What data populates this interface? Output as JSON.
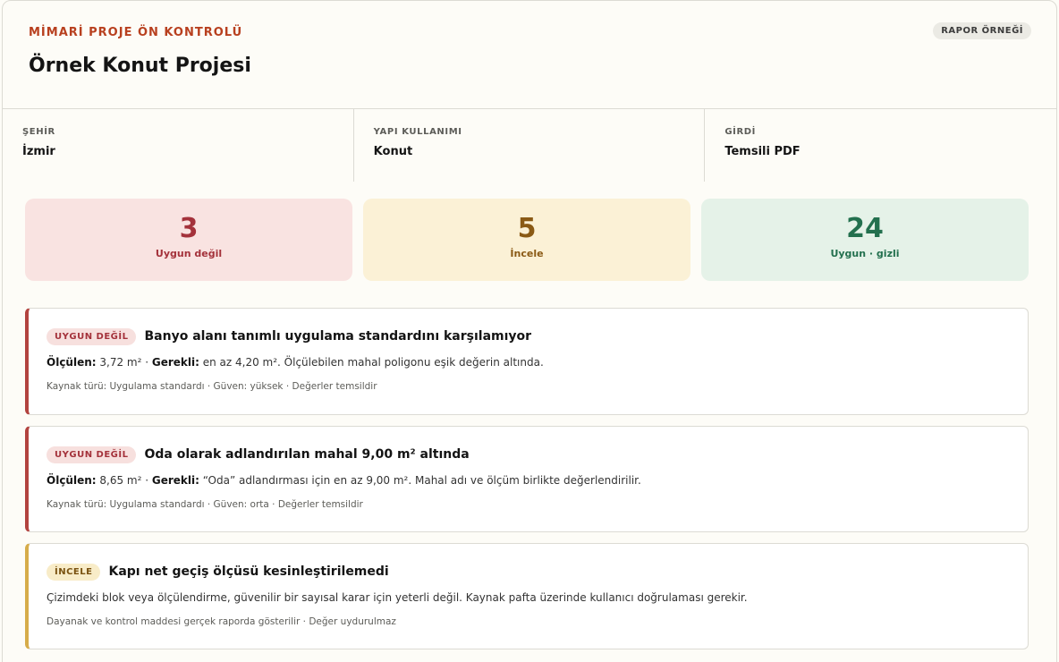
{
  "header": {
    "eyebrow": "MİMARİ PROJE ÖN KONTROLÜ",
    "title": "Örnek Konut Projesi",
    "badge": "RAPOR ÖRNEĞİ"
  },
  "meta": [
    {
      "label": "ŞEHİR",
      "value": "İzmir"
    },
    {
      "label": "YAPI KULLANIMI",
      "value": "Konut"
    },
    {
      "label": "GİRDİ",
      "value": "Temsili PDF"
    }
  ],
  "stats": [
    {
      "number": "3",
      "label": "Uygun değil",
      "color": "#a4323b"
    },
    {
      "number": "5",
      "label": "İncele",
      "color": "#8a5a15"
    },
    {
      "number": "24",
      "label": "Uygun · gizli",
      "color": "#23704e"
    }
  ],
  "findings": [
    {
      "tag": "UYGUN DEĞİL",
      "title": "Banyo alanı tanımlı uygulama standardını karşılamıyor",
      "measured_label": "Ölçülen:",
      "measured_value": " 3,72 m² · ",
      "required_label": "Gerekli:",
      "required_value": " en az 4,20 m². Ölçülebilen mahal poligonu eşik değerin altında.",
      "footer": "Kaynak türü: Uygulama standardı · Güven: yüksek · Değerler temsildir"
    },
    {
      "tag": "UYGUN DEĞİL",
      "title": "Oda olarak adlandırılan mahal 9,00 m² altında",
      "measured_label": "Ölçülen:",
      "measured_value": " 8,65 m² · ",
      "required_label": "Gerekli:",
      "required_value": " “Oda” adlandırması için en az 9,00 m². Mahal adı ve ölçüm birlikte değerlendirilir.",
      "footer": "Kaynak türü: Uygulama standardı · Güven: orta · Değerler temsildir"
    },
    {
      "tag": "İNCELE",
      "title": "Kapı net geçiş ölçüsü kesinleştirilemedi",
      "body": "Çizimdeki blok veya ölçülendirme, güvenilir bir sayısal karar için yeterli değil. Kaynak pafta üzerinde kullanıcı doğrulaması gerekir.",
      "footer": "Dayanak ve kontrol maddesi gerçek raporda gösterilir · Değer uydurulmaz"
    }
  ]
}
